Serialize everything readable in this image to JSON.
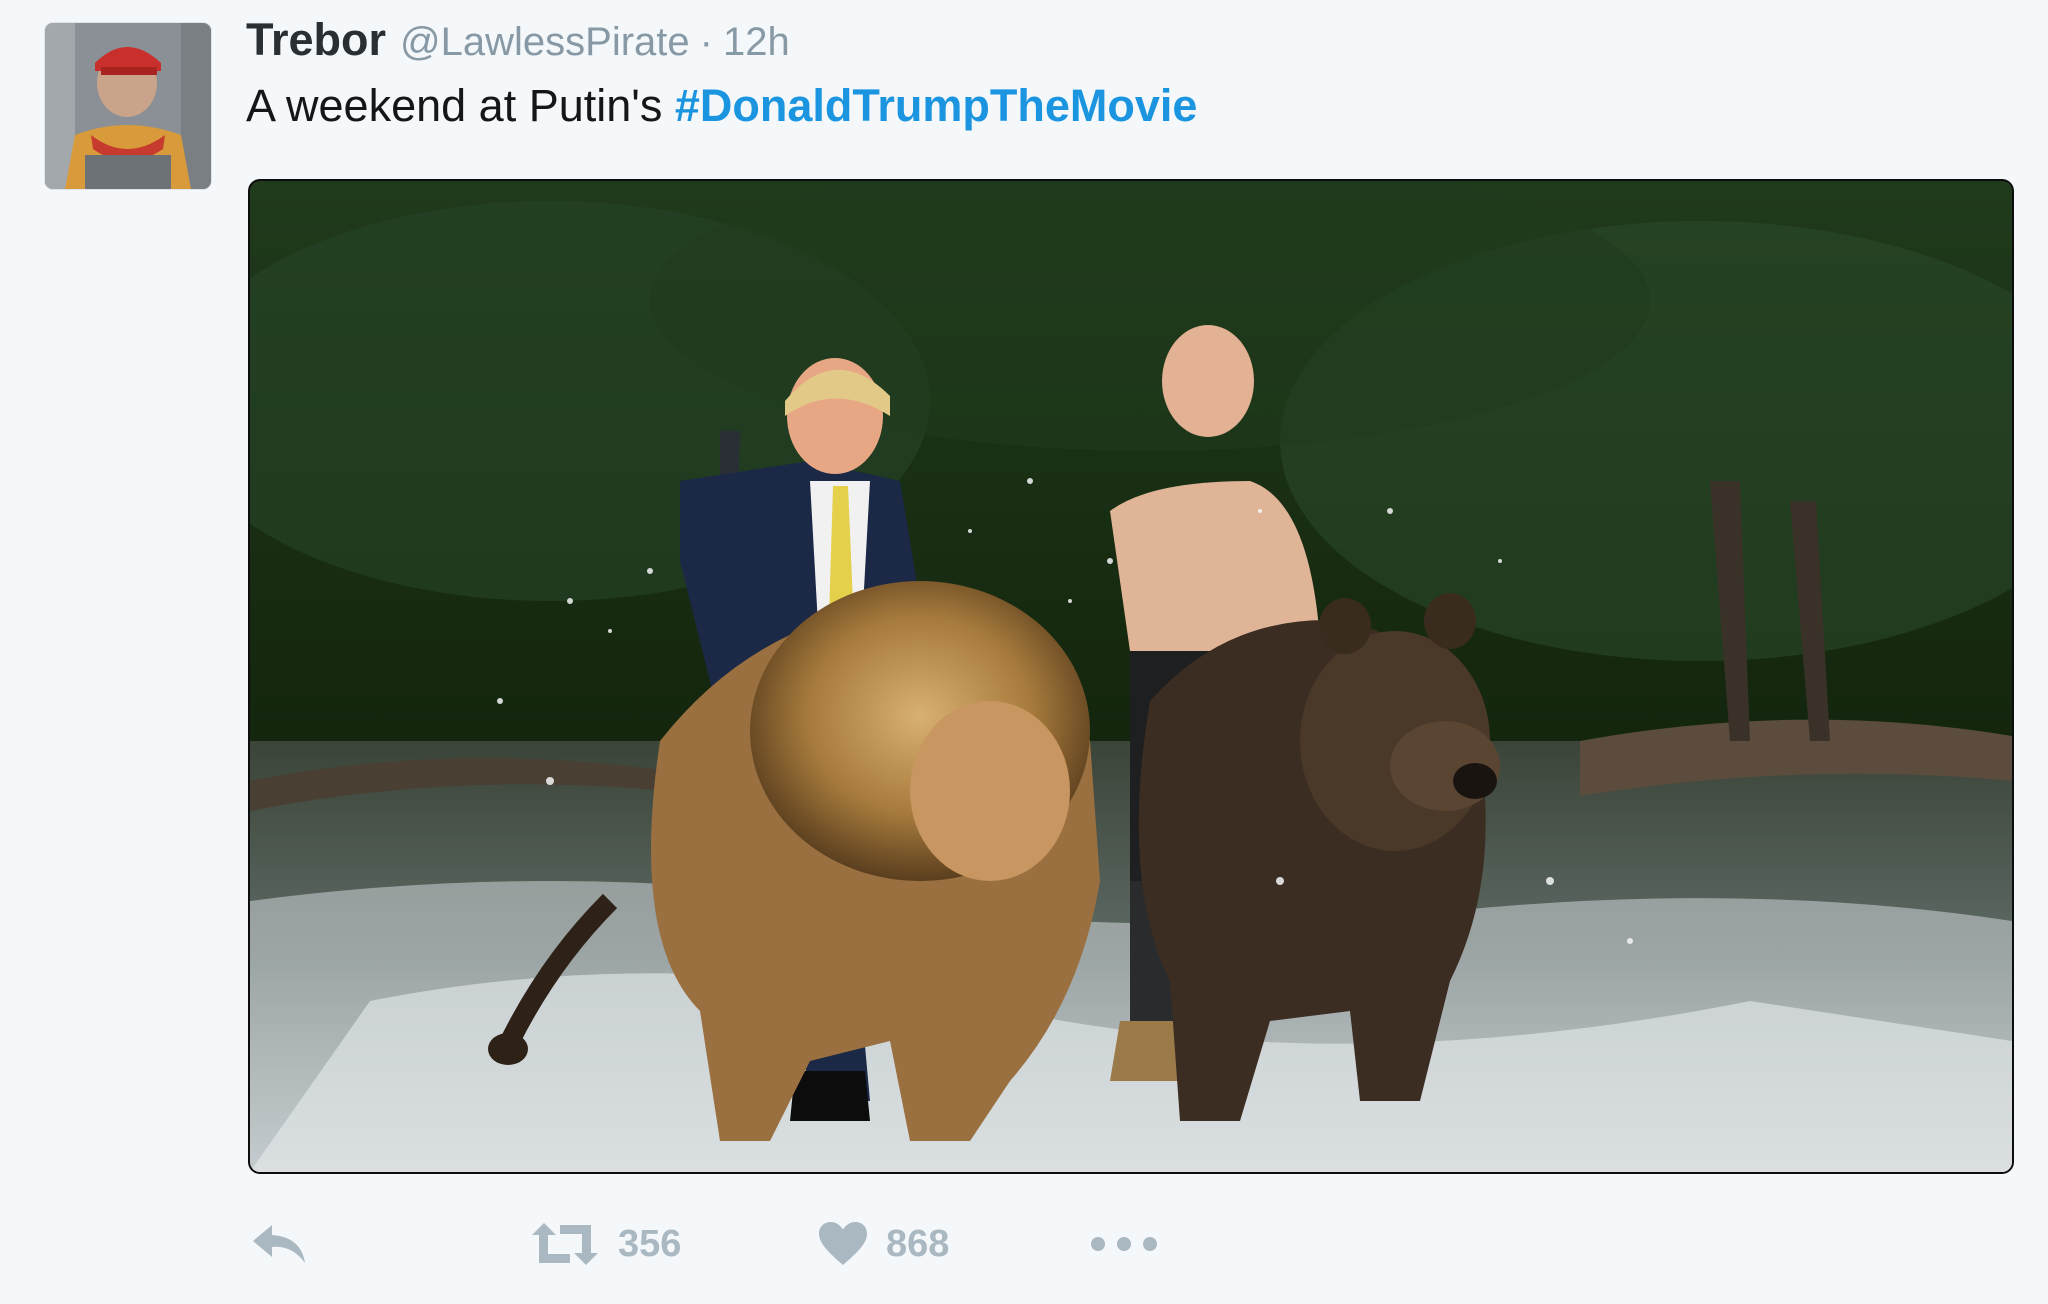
{
  "tweet": {
    "author": {
      "name": "Trebor",
      "handle": "@LawlessPirate",
      "separator": "·",
      "time": "12h"
    },
    "text": "A weekend at Putin's ",
    "hashtag": "#DonaldTrumpTheMovie",
    "actions": {
      "reply_icon": "reply-arrow-icon",
      "retweet_icon": "retweet-icon",
      "retweet_count": "356",
      "like_icon": "heart-icon",
      "like_count": "868",
      "more_icon": "more-dots-icon"
    }
  },
  "colors": {
    "background": "#f5f8fa",
    "name": "#292f33",
    "muted": "#8899a6",
    "hashtag": "#1b95e0",
    "action_gray": "#aab8c2"
  }
}
